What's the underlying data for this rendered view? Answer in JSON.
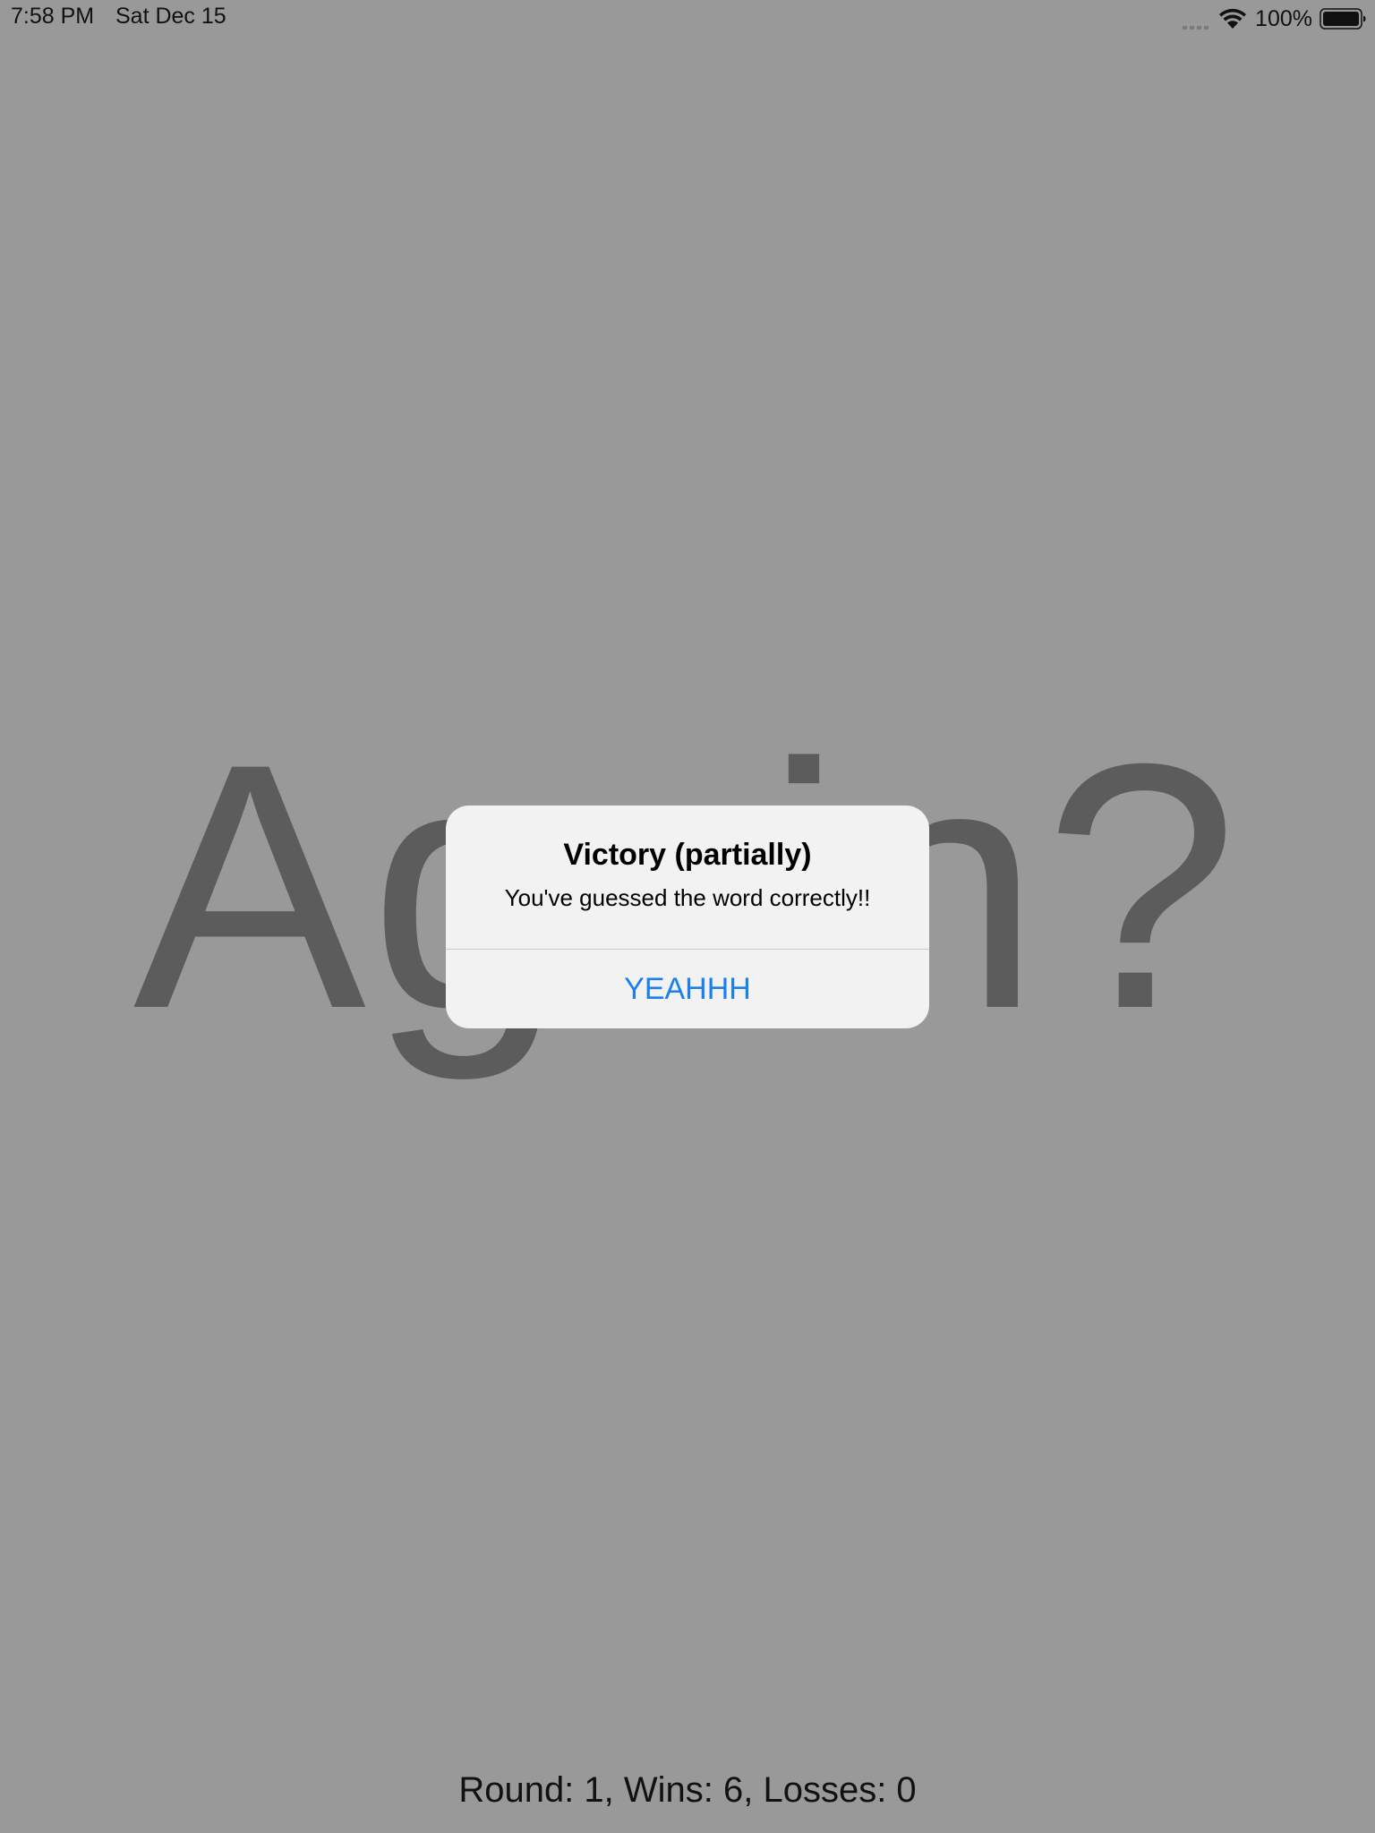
{
  "status_bar": {
    "time": "7:58 PM",
    "date": "Sat Dec 15",
    "battery": "100%",
    "icons": [
      "cellular-signal-icon",
      "wifi-icon",
      "battery-icon"
    ]
  },
  "game": {
    "prompt_word": "Again?",
    "score_text": "Round: 1, Wins: 6, Losses: 0"
  },
  "alert": {
    "title": "Victory (partially)",
    "message": "You've guessed the word correctly!!",
    "button_label": "YEAHHH"
  },
  "colors": {
    "background": "#999999",
    "alert_background": "#f2f2f2",
    "button_text": "#1a7ff0",
    "big_word": "#5c5c5c"
  }
}
